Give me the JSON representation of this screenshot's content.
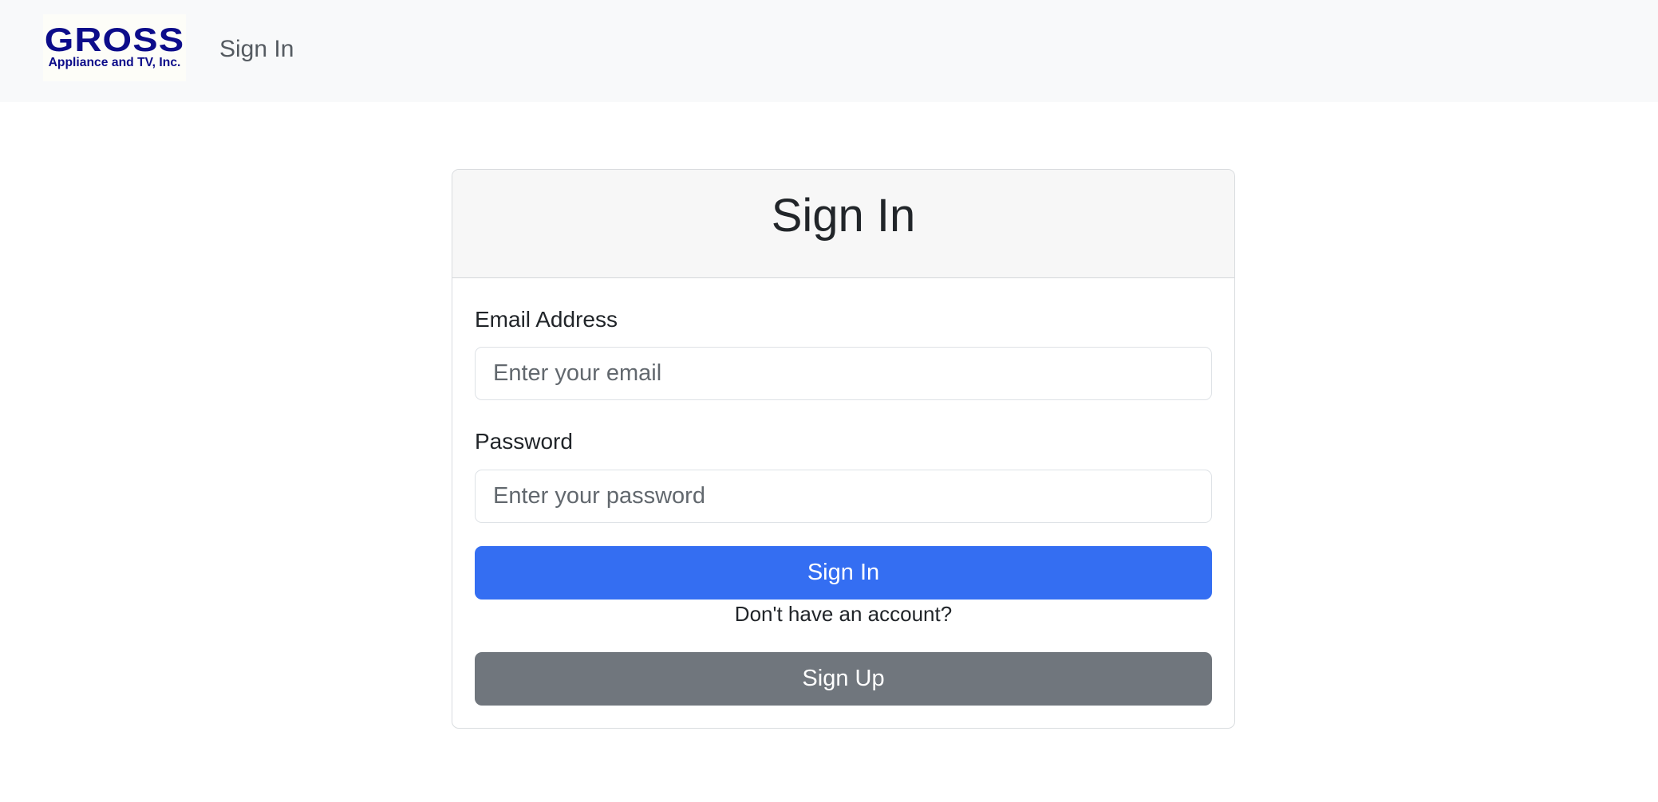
{
  "navbar": {
    "logo": {
      "title": "GROSS",
      "subtitle": "Appliance and TV, Inc.",
      "color": "#0c0c8a"
    },
    "link_label": "Sign In"
  },
  "card": {
    "title": "Sign In",
    "email": {
      "label": "Email Address",
      "placeholder": "Enter your email",
      "value": ""
    },
    "password": {
      "label": "Password",
      "placeholder": "Enter your password",
      "value": ""
    },
    "sign_in_button": "Sign In",
    "no_account_text": "Don't have an account?",
    "sign_up_button": "Sign Up"
  },
  "colors": {
    "primary": "#346ef2",
    "secondary": "#70767d",
    "navbar_bg": "#f8f9fa"
  }
}
